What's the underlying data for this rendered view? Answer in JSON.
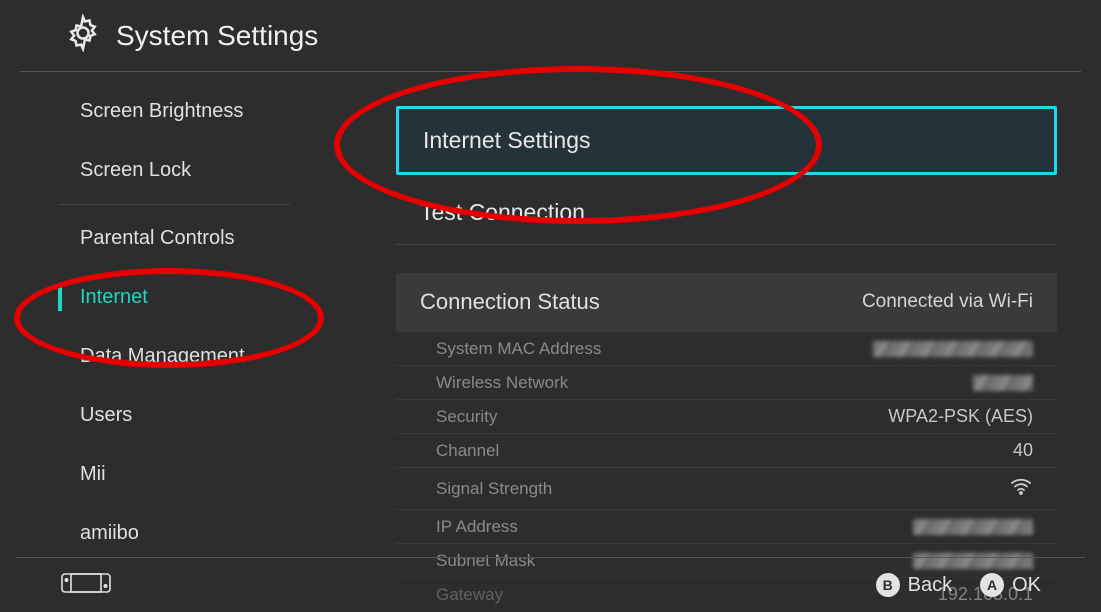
{
  "header": {
    "title": "System Settings"
  },
  "sidebar": {
    "items": [
      {
        "label": "Screen Brightness"
      },
      {
        "label": "Screen Lock"
      },
      {
        "label": "Parental Controls"
      },
      {
        "label": "Internet"
      },
      {
        "label": "Data Management"
      },
      {
        "label": "Users"
      },
      {
        "label": "Mii"
      },
      {
        "label": "amiibo"
      }
    ],
    "active_index": 3,
    "separator_after_index": 1
  },
  "content": {
    "menu": [
      {
        "label": "Internet Settings",
        "selected": true
      },
      {
        "label": "Test Connection",
        "selected": false
      }
    ],
    "status": {
      "header_label": "Connection Status",
      "header_value": "Connected via Wi-Fi",
      "details": [
        {
          "label": "System MAC Address",
          "value": "",
          "redacted": true
        },
        {
          "label": "Wireless Network",
          "value": "",
          "redacted": true
        },
        {
          "label": "Security",
          "value": "WPA2-PSK (AES)",
          "redacted": false
        },
        {
          "label": "Channel",
          "value": "40",
          "redacted": false
        },
        {
          "label": "Signal Strength",
          "value": "",
          "icon": "wifi"
        },
        {
          "label": "IP Address",
          "value": "",
          "redacted": true
        },
        {
          "label": "Subnet Mask",
          "value": "",
          "redacted": true
        },
        {
          "label": "Gateway",
          "value": "192.168.0.1",
          "redacted": false,
          "cutoff": true
        }
      ]
    }
  },
  "footer": {
    "back": {
      "glyph": "B",
      "label": "Back"
    },
    "ok": {
      "glyph": "A",
      "label": "OK"
    }
  },
  "annotations": {
    "ellipses": [
      {
        "target": "internet-settings"
      },
      {
        "target": "sidebar-internet"
      }
    ]
  }
}
